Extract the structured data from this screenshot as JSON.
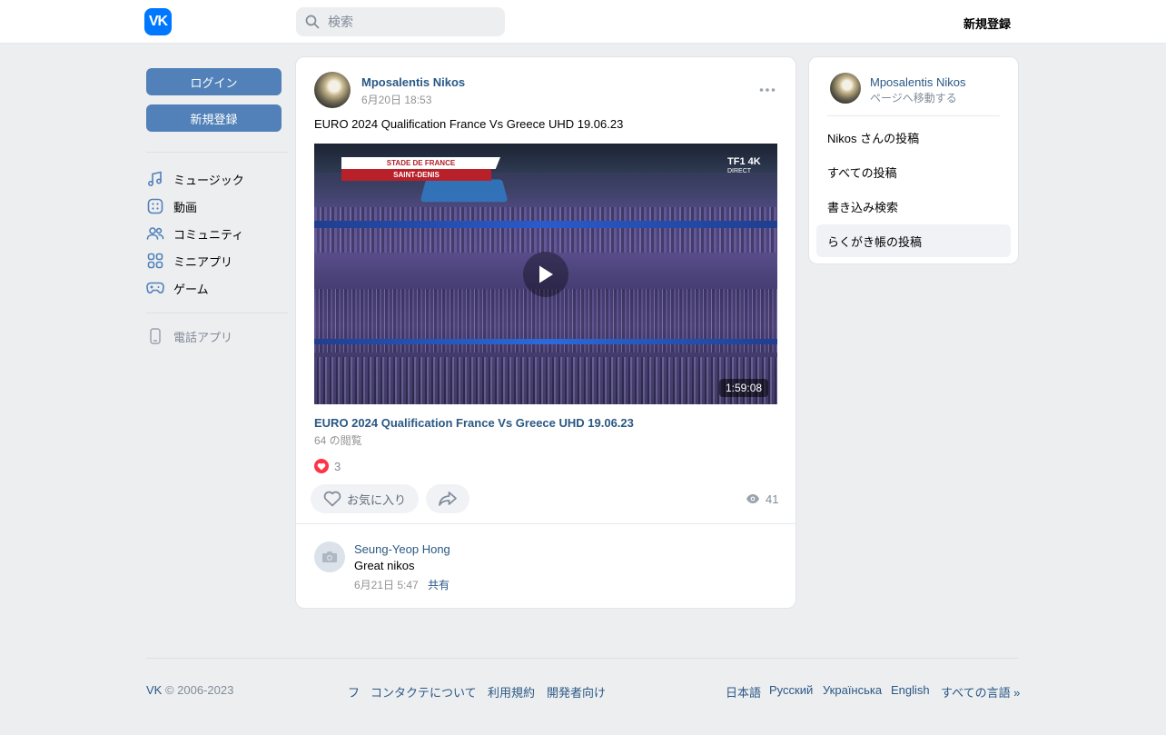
{
  "header": {
    "logo_text": "VK",
    "search_placeholder": "検索",
    "register_label": "新規登録"
  },
  "sidebar": {
    "login_label": "ログイン",
    "register_label": "新規登録",
    "items": [
      {
        "label": "ミュージック",
        "icon": "music-icon"
      },
      {
        "label": "動画",
        "icon": "video-icon"
      },
      {
        "label": "コミュニティ",
        "icon": "community-icon"
      },
      {
        "label": "ミニアプリ",
        "icon": "mini-apps-icon"
      },
      {
        "label": "ゲーム",
        "icon": "gamepad-icon"
      }
    ],
    "phone_app_label": "電話アプリ"
  },
  "post": {
    "author": "Mposalentis Nikos",
    "date": "6月20日 18:53",
    "text": "EURO 2024 Qualification France Vs Greece UHD 19.06.23",
    "video": {
      "overlay_top": "STADE DE FRANCE",
      "overlay_bottom": "SAINT-DENIS",
      "channel": "TF1 4K",
      "channel_sub": "DIRECT",
      "duration": "1:59:08",
      "title": "EURO 2024 Qualification France Vs Greece UHD 19.06.23",
      "views": "64 の閲覧"
    },
    "reactions_count": "3",
    "like_label": "お気に入り",
    "views_count": "41",
    "comment": {
      "author": "Seung-Yeop Hong",
      "text": "Great nikos",
      "date": "6月21日 5:47",
      "share_label": "共有"
    }
  },
  "right_panel": {
    "name": "Mposalentis Nikos",
    "subtitle": "ページへ移動する",
    "items": [
      {
        "label": "Nikos さんの投稿",
        "active": false
      },
      {
        "label": "すべての投稿",
        "active": false
      },
      {
        "label": "書き込み検索",
        "active": false
      },
      {
        "label": "らくがき帳の投稿",
        "active": true
      }
    ]
  },
  "footer": {
    "brand": "VK",
    "copyright": "© 2006-2023",
    "links_center": [
      "フ",
      "コンタクテについて",
      "利用規約",
      "開発者向け"
    ],
    "languages": [
      "日本語",
      "Русский",
      "Українська",
      "English",
      "すべての言語 »"
    ]
  },
  "colors": {
    "accent": "#5181b8",
    "link": "#2a5885",
    "background": "#edeef0",
    "like_red": "#ff3347"
  }
}
